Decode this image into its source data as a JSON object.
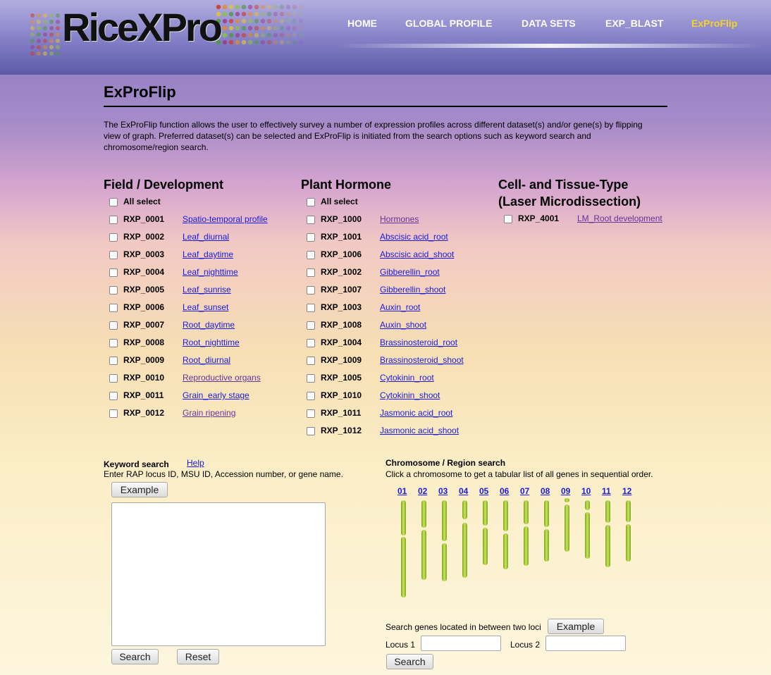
{
  "colors": {
    "nav_active": "#f5d22a",
    "link": "#1a1ae0",
    "visited_link": "#663399",
    "chromosome": "#9acd32"
  },
  "header": {
    "logo_text": "RiceXPro",
    "nav": [
      "HOME",
      "GLOBAL PROFILE",
      "DATA SETS",
      "EXP_BLAST",
      "ExProFlip"
    ]
  },
  "page": {
    "title": "ExProFlip",
    "intro": "The ExProFlip function allows the user to effectively survey a number of expression profiles across different dataset(s) and/or gene(s) by flipping view of graph. Preferred dataset(s) can be selected and ExProFlip is initiated from the search options such as keyword search and chromosome/region search."
  },
  "field": {
    "heading": "Field / Development",
    "all_select": "All select",
    "items": [
      {
        "id": "RXP_0001",
        "label": "Spatio-temporal profile"
      },
      {
        "id": "RXP_0002",
        "label": "Leaf_diurnal"
      },
      {
        "id": "RXP_0003",
        "label": "Leaf_daytime"
      },
      {
        "id": "RXP_0004",
        "label": "Leaf_nighttime"
      },
      {
        "id": "RXP_0005",
        "label": "Leaf_sunrise"
      },
      {
        "id": "RXP_0006",
        "label": "Leaf_sunset"
      },
      {
        "id": "RXP_0007",
        "label": "Root_daytime"
      },
      {
        "id": "RXP_0008",
        "label": "Root_nighttime"
      },
      {
        "id": "RXP_0009",
        "label": "Root_diurnal"
      },
      {
        "id": "RXP_0010",
        "label": "Reproductive organs"
      },
      {
        "id": "RXP_0011",
        "label": "Grain_early stage"
      },
      {
        "id": "RXP_0012",
        "label": "Grain ripening"
      }
    ]
  },
  "hormone": {
    "heading": "Plant Hormone",
    "all_select": "All select",
    "items": [
      {
        "id": "RXP_1000",
        "label": "Hormones"
      },
      {
        "id": "RXP_1001",
        "label": "Abscisic acid_root"
      },
      {
        "id": "RXP_1006",
        "label": "Abscisic acid_shoot"
      },
      {
        "id": "RXP_1002",
        "label": "Gibberellin_root"
      },
      {
        "id": "RXP_1007",
        "label": "Gibberellin_shoot"
      },
      {
        "id": "RXP_1003",
        "label": "Auxin_root"
      },
      {
        "id": "RXP_1008",
        "label": "Auxin_shoot"
      },
      {
        "id": "RXP_1004",
        "label": "Brassinosteroid_root"
      },
      {
        "id": "RXP_1009",
        "label": "Brassinosteroid_shoot"
      },
      {
        "id": "RXP_1005",
        "label": "Cytokinin_root"
      },
      {
        "id": "RXP_1010",
        "label": "Cytokinin_shoot"
      },
      {
        "id": "RXP_1011",
        "label": "Jasmonic acid_root"
      },
      {
        "id": "RXP_1012",
        "label": "Jasmonic acid_shoot"
      }
    ]
  },
  "cell": {
    "heading_line1": "Cell- and Tissue-Type",
    "heading_line2": "(Laser Microdissection)",
    "items": [
      {
        "id": "RXP_4001",
        "label": "LM_Root development"
      }
    ]
  },
  "keyword": {
    "title": "Keyword search",
    "help": "Help",
    "desc": "Enter RAP locus ID, MSU ID, Accession number, or gene name.",
    "example": "Example",
    "search": "Search",
    "reset": "Reset",
    "textarea_value": ""
  },
  "chromosome": {
    "title": "Chromosome / Region search",
    "desc": "Click a chromosome to get a tabular list of all genes in sequential order.",
    "numbers": [
      "01",
      "02",
      "03",
      "04",
      "05",
      "06",
      "07",
      "08",
      "09",
      "10",
      "11",
      "12"
    ],
    "between_label": "Search genes located in between two loci",
    "example": "Example",
    "locus1_label": "Locus 1",
    "locus2_label": "Locus 2",
    "locus1_value": "",
    "locus2_value": "",
    "search": "Search"
  }
}
